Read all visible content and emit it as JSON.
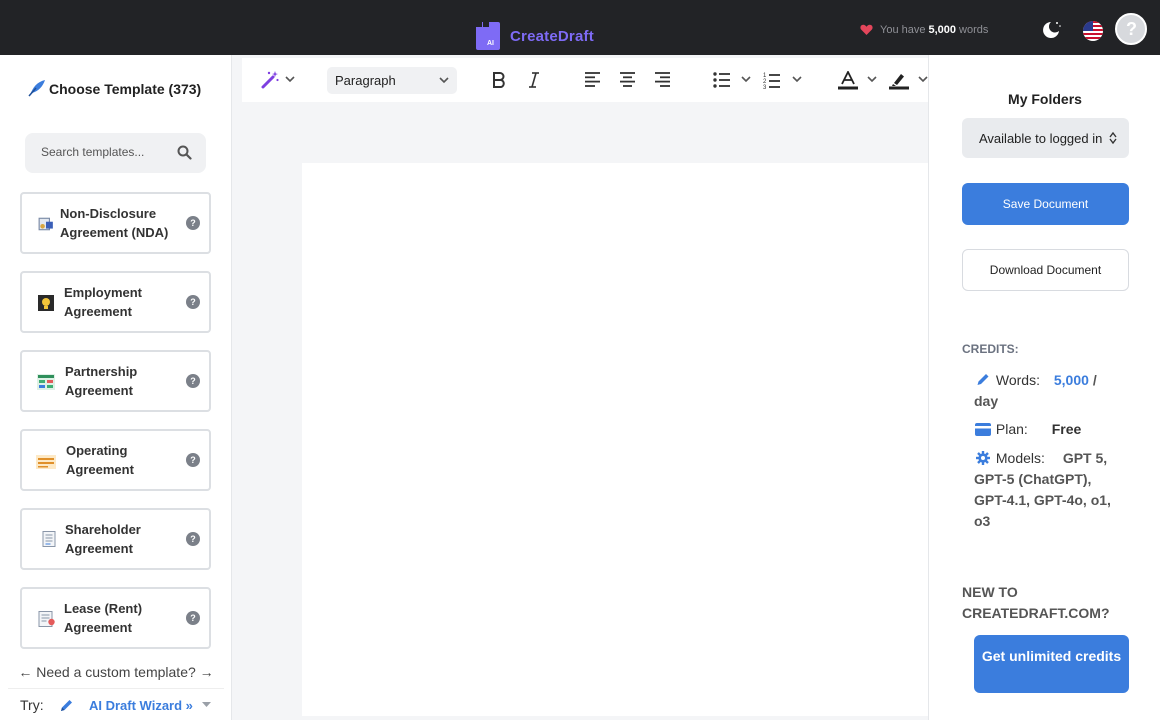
{
  "header": {
    "brand": "CreateDraft",
    "words_prefix": "You have",
    "words_count": "5,000",
    "words_suffix": "words",
    "accent_color": "#7e6bf5"
  },
  "sidebar": {
    "title": "Choose Template (373)",
    "search_placeholder": "Search templates...",
    "templates": [
      {
        "label": "Non-Disclosure Agreement (NDA)",
        "icon": "nda-icon"
      },
      {
        "label": "Employment Agreement",
        "icon": "employment-icon"
      },
      {
        "label": "Partnership Agreement",
        "icon": "partnership-icon"
      },
      {
        "label": "Operating Agreement",
        "icon": "operating-icon"
      },
      {
        "label": "Shareholder Agreement",
        "icon": "shareholder-icon"
      },
      {
        "label": "Lease (Rent) Agreement",
        "icon": "lease-icon"
      }
    ],
    "help_glyph": "?",
    "custom_template": "← Need a custom template? →",
    "try_label": "Try:",
    "wizard_label": "AI Draft Wizard »"
  },
  "editor": {
    "block_format": "Paragraph"
  },
  "right_panel": {
    "folders_title": "My Folders",
    "folder_value": "Available to logged in",
    "save_label": "Save Document",
    "download_label": "Download Document",
    "credits_heading": "CREDITS:",
    "words_label": "Words:",
    "words_value": "5,000",
    "words_unit": "/ day",
    "plan_label": "Plan:",
    "plan_value": "Free",
    "models_label": "Models:",
    "models_value": "GPT 5, GPT-5 (ChatGPT), GPT-4.1, GPT-4o, o1, o3",
    "new_to": "NEW TO CREATEDRAFT.COM?",
    "unlimited_label": "Get unlimited credits",
    "primary_color": "#3b7ddd"
  }
}
